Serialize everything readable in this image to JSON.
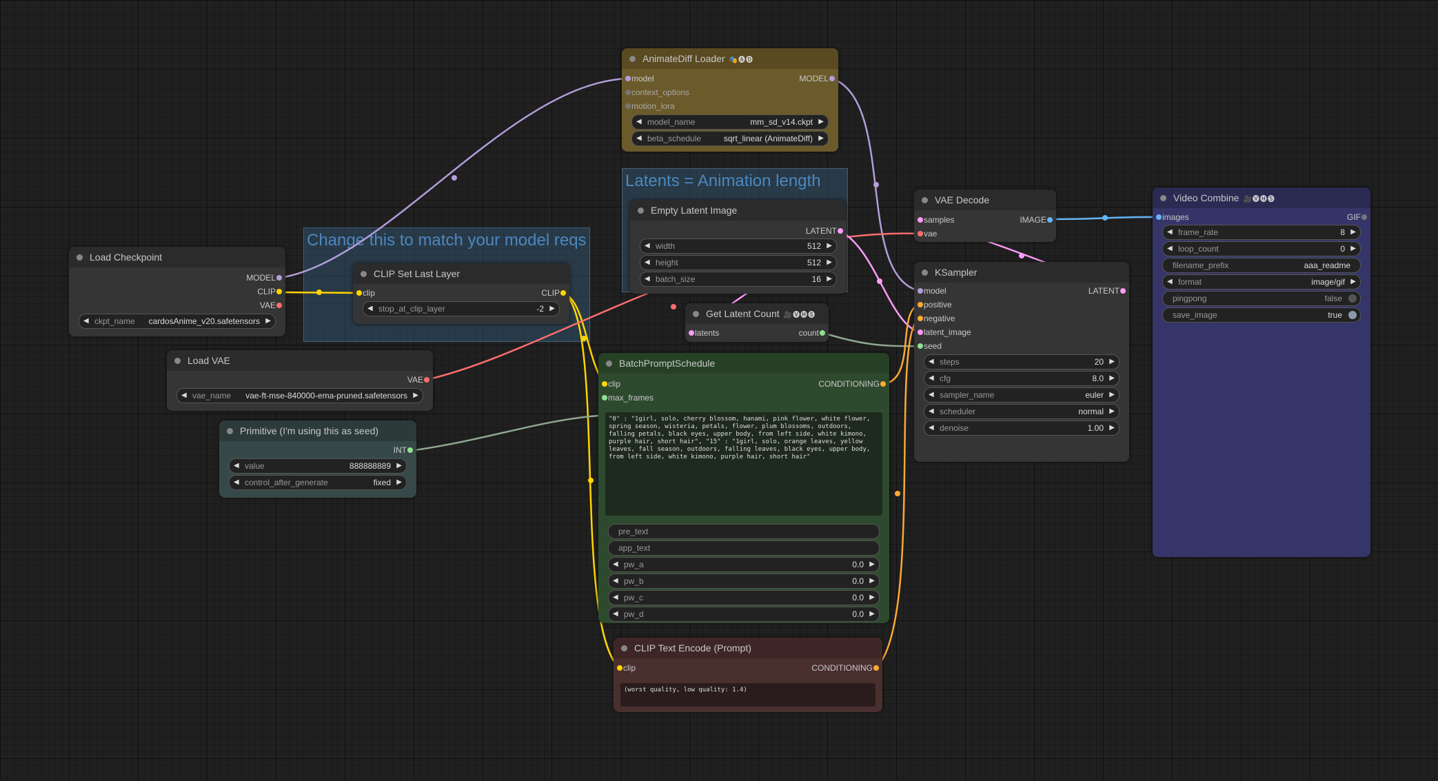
{
  "groups": {
    "model_reqs": "Change this to match your model reqs",
    "latents": "Latents = Animation length"
  },
  "colors": {
    "model": "#b39ddb",
    "clip": "#ffd500",
    "vae": "#ff6e6e",
    "latent": "#ff9cf9",
    "image": "#64b5f6",
    "int": "#8fa88f",
    "conditioning": "#ffa931"
  },
  "load_checkpoint": {
    "title": "Load Checkpoint",
    "outputs": [
      "MODEL",
      "CLIP",
      "VAE"
    ],
    "ckpt_name_label": "ckpt_name",
    "ckpt_name": "cardosAnime_v20.safetensors"
  },
  "clip_set_last_layer": {
    "title": "CLIP Set Last Layer",
    "input": "clip",
    "output": "CLIP",
    "stop_label": "stop_at_clip_layer",
    "stop_value": "-2"
  },
  "load_vae": {
    "title": "Load VAE",
    "output": "VAE",
    "vae_name_label": "vae_name",
    "vae_name": "vae-ft-mse-840000-ema-pruned.safetensors"
  },
  "primitive": {
    "title": "Primitive (I'm using this as seed)",
    "output": "INT",
    "value_label": "value",
    "value": "888888889",
    "control_label": "control_after_generate",
    "control": "fixed"
  },
  "animatediff_loader": {
    "title": "AnimateDiff Loader",
    "badges": "🎭🅐🅓",
    "inputs": [
      "model",
      "context_options",
      "motion_lora"
    ],
    "output": "MODEL",
    "model_name_label": "model_name",
    "model_name": "mm_sd_v14.ckpt",
    "beta_label": "beta_schedule",
    "beta": "sqrt_linear (AnimateDiff)"
  },
  "empty_latent": {
    "title": "Empty Latent Image",
    "output": "LATENT",
    "width_label": "width",
    "width": "512",
    "height_label": "height",
    "height": "512",
    "batch_label": "batch_size",
    "batch": "16"
  },
  "get_latent_count": {
    "title": "Get Latent Count",
    "badges": "🎥🅥🅗🅢",
    "input": "latents",
    "output": "count"
  },
  "batch_prompt": {
    "title": "BatchPromptSchedule",
    "inputs": [
      "clip",
      "max_frames"
    ],
    "output": "CONDITIONING",
    "text": "\"0\" : \"1girl, solo, cherry blossom, hanami, pink flower, white flower, spring season, wisteria, petals, flower, plum blossoms, outdoors, falling petals, black eyes, upper body, from left side, white kimono, purple hair, short hair\", \"15\" : \"1girl, solo, orange leaves, yellow leaves, fall season, outdoors, falling leaves, black eyes, upper body, from left side, white kimono, purple hair, short hair\"",
    "pre_text": "pre_text",
    "app_text": "app_text",
    "pw_a_label": "pw_a",
    "pw_a": "0.0",
    "pw_b_label": "pw_b",
    "pw_b": "0.0",
    "pw_c_label": "pw_c",
    "pw_c": "0.0",
    "pw_d_label": "pw_d",
    "pw_d": "0.0"
  },
  "clip_text_encode": {
    "title": "CLIP Text Encode (Prompt)",
    "input": "clip",
    "output": "CONDITIONING",
    "text": "(worst quality, low quality: 1.4)"
  },
  "vae_decode": {
    "title": "VAE Decode",
    "inputs": [
      "samples",
      "vae"
    ],
    "output": "IMAGE"
  },
  "ksampler": {
    "title": "KSampler",
    "inputs": [
      "model",
      "positive",
      "negative",
      "latent_image",
      "seed"
    ],
    "output": "LATENT",
    "steps_label": "steps",
    "steps": "20",
    "cfg_label": "cfg",
    "cfg": "8.0",
    "sampler_label": "sampler_name",
    "sampler": "euler",
    "scheduler_label": "scheduler",
    "scheduler": "normal",
    "denoise_label": "denoise",
    "denoise": "1.00"
  },
  "video_combine": {
    "title": "Video Combine",
    "badges": "🎥🅥🅗🅢",
    "input": "images",
    "output": "GIF",
    "frame_rate_label": "frame_rate",
    "frame_rate": "8",
    "loop_count_label": "loop_count",
    "loop_count": "0",
    "filename_prefix_label": "filename_prefix",
    "filename_prefix": "aaa_readme",
    "format_label": "format",
    "format": "image/gif",
    "pingpong_label": "pingpong",
    "pingpong": "false",
    "save_image_label": "save_image",
    "save_image": "true"
  }
}
